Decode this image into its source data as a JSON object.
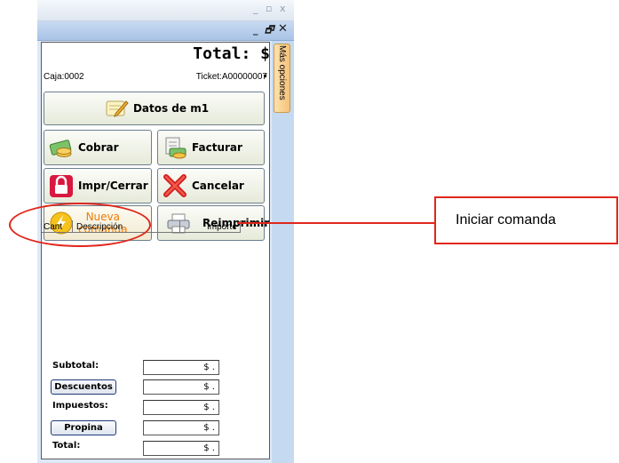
{
  "window": {
    "background_title_buttons": {
      "minimize": "_",
      "maximize": "▫",
      "close": "x"
    },
    "title_buttons": {
      "minimize": "_",
      "maximize": "🗗",
      "close": "✕"
    }
  },
  "header": {
    "total_label": "Total: $ .",
    "caja": "Caja:0002",
    "ticket": "Ticket:A00000007"
  },
  "buttons": {
    "datos": "Datos de m1",
    "cobrar": "Cobrar",
    "facturar": "Facturar",
    "impr_cerrar": "Impr/Cerrar",
    "cancelar": "Cancelar",
    "nueva_comanda_line1": "Nueva",
    "nueva_comanda_line2": "comanda",
    "reimprimir": "Reimprimir"
  },
  "table": {
    "columns": [
      "Cant",
      "Descripción",
      "Importe"
    ],
    "rows": []
  },
  "totals": {
    "subtotal_label": "Subtotal:",
    "descuentos_label": "Descuentos",
    "impuestos_label": "Impuestos:",
    "propina_label": "Propina",
    "total_label": "Total:",
    "subtotal_value": "$ .",
    "descuentos_value": "$ .",
    "impuestos_value": "$ .",
    "propina_value": "$ .",
    "total_value": "$ ."
  },
  "side_tab": {
    "label": "Más opciones"
  },
  "annotation": {
    "label": "Iniciar comanda",
    "color": "#e0261b"
  },
  "colors": {
    "accent_orange": "#f07c00",
    "panel_blue": "#c5d9f0"
  },
  "icons": {
    "datos": "notepad-pencil-icon",
    "cobrar": "money-coins-icon",
    "facturar": "invoice-money-icon",
    "impr_cerrar": "lock-icon",
    "cancelar": "red-x-icon",
    "nueva_comanda": "lightning-icon",
    "reimprimir": "printer-icon"
  }
}
